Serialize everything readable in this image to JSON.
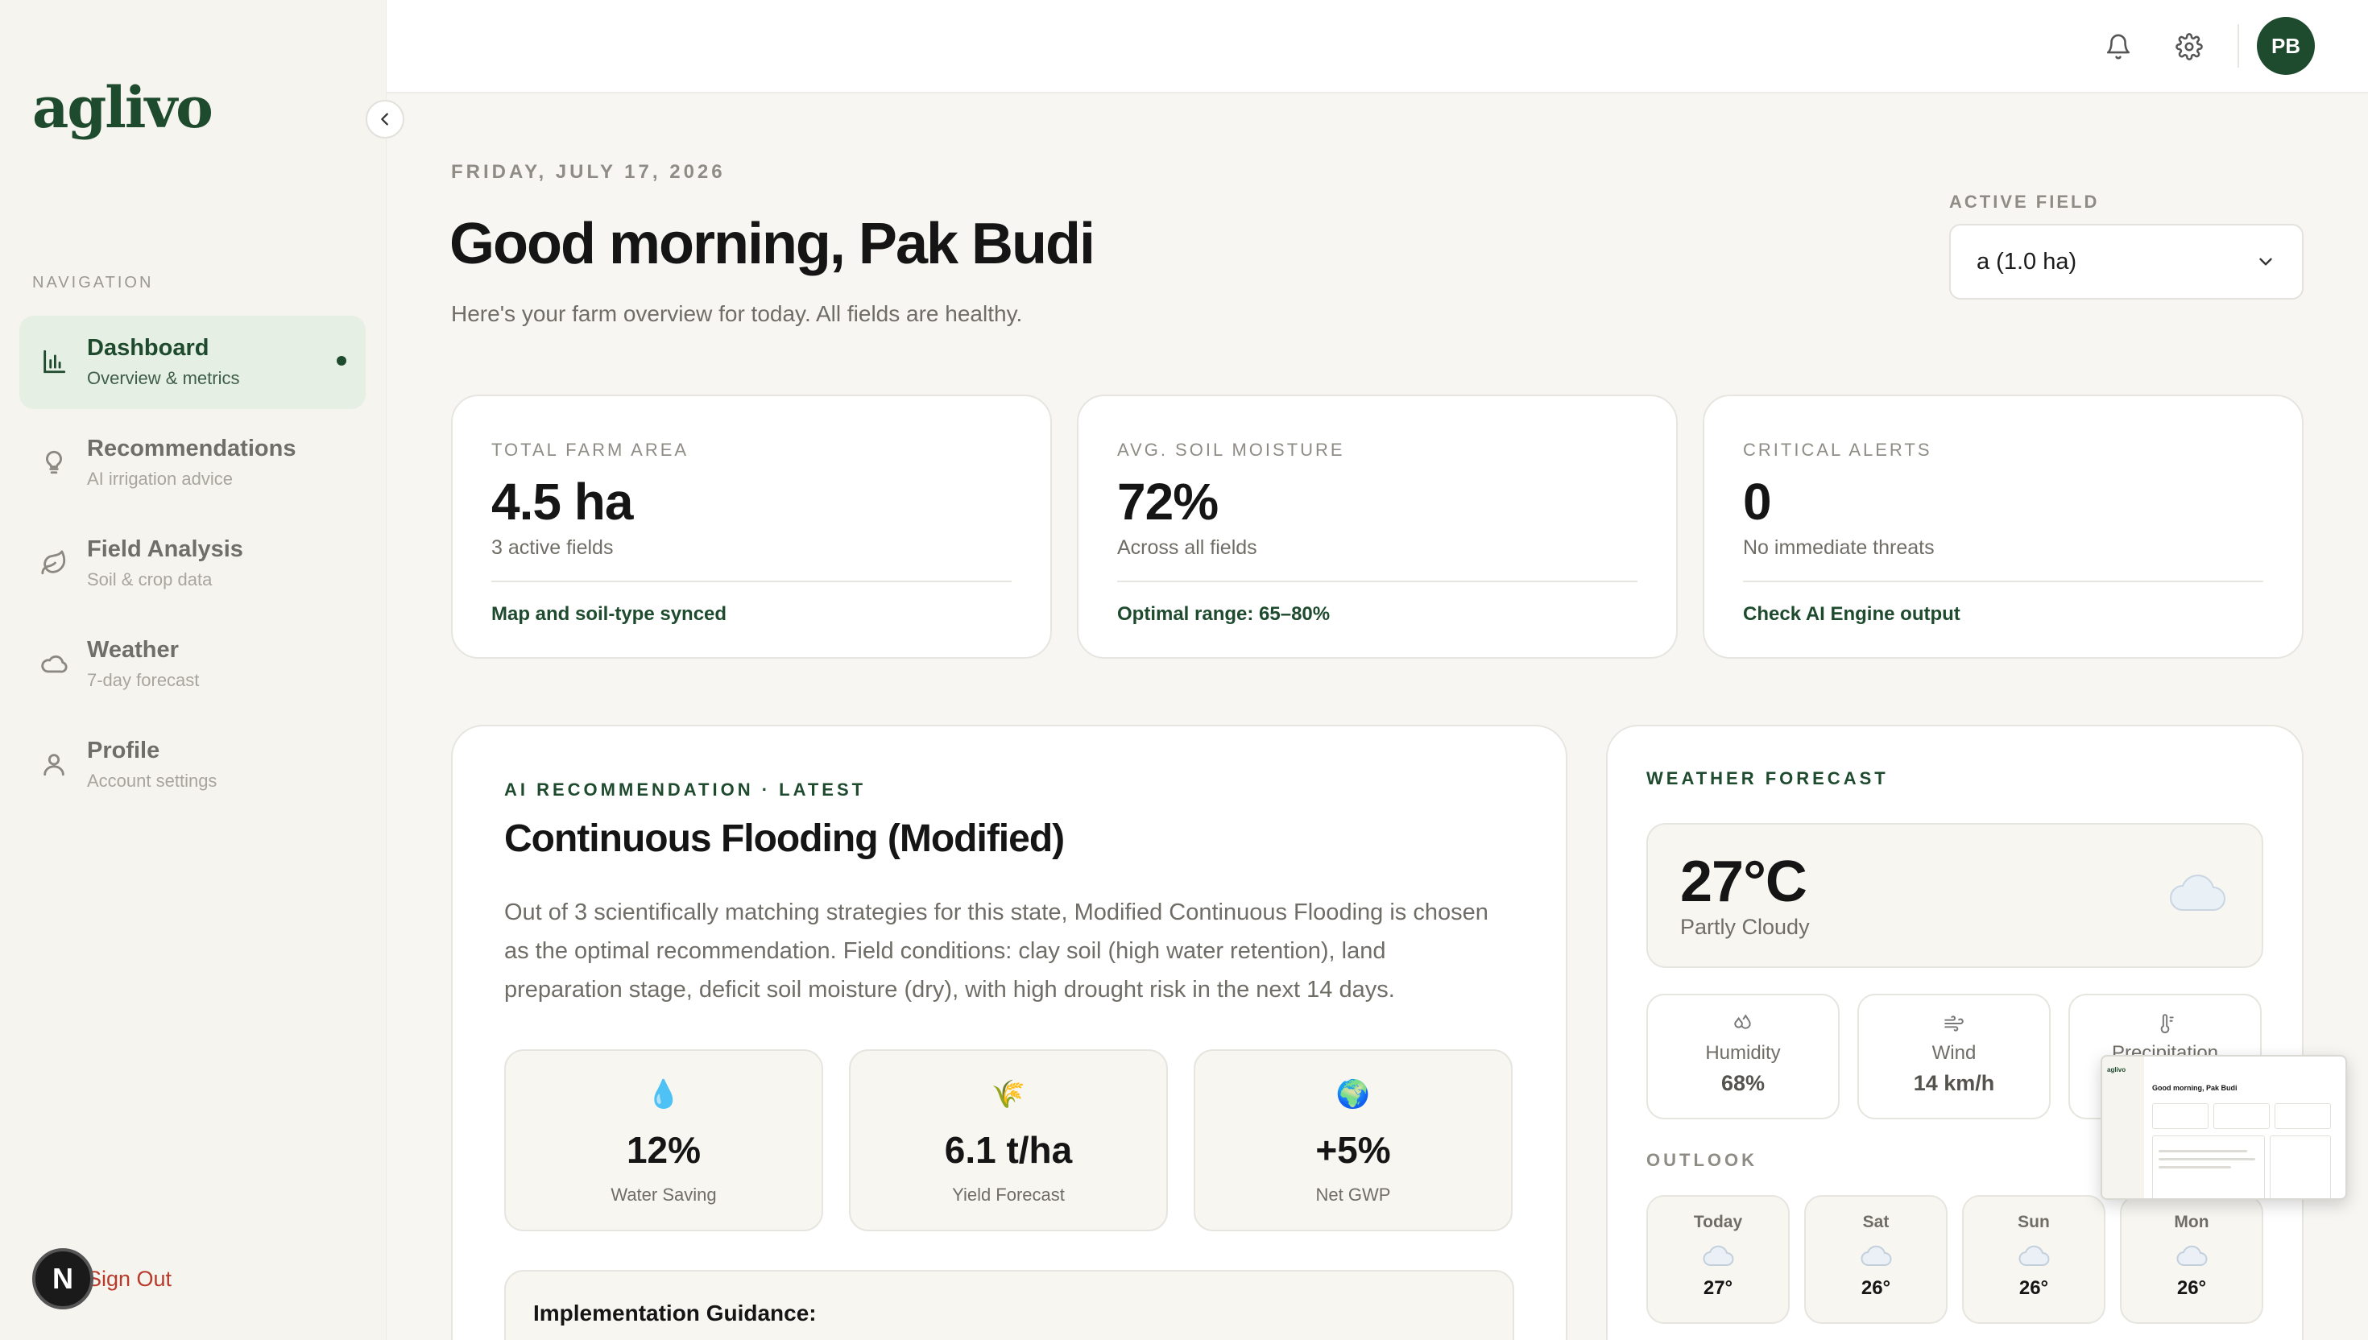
{
  "app": {
    "logo_text": "aglivo",
    "nav_label": "NAVIGATION",
    "signout_label": "Sign Out",
    "n_badge": "N"
  },
  "sidebar": {
    "items": [
      {
        "label": "Dashboard",
        "sub": "Overview & metrics",
        "icon": "bar-chart-icon",
        "active": true
      },
      {
        "label": "Recommendations",
        "sub": "AI irrigation advice",
        "icon": "lightbulb-icon",
        "active": false
      },
      {
        "label": "Field Analysis",
        "sub": "Soil & crop data",
        "icon": "leaf-icon",
        "active": false
      },
      {
        "label": "Weather",
        "sub": "7-day forecast",
        "icon": "cloud-icon",
        "active": false
      },
      {
        "label": "Profile",
        "sub": "Account settings",
        "icon": "user-icon",
        "active": false
      }
    ]
  },
  "topbar": {
    "avatar_initials": "PB",
    "icons": [
      "bell-icon",
      "gear-icon"
    ]
  },
  "header": {
    "date": "FRIDAY, JULY 17, 2026",
    "greeting": "Good morning, Pak Budi",
    "subtitle": "Here's your farm overview for today. All fields are healthy.",
    "active_field_label": "ACTIVE FIELD",
    "active_field_value": "a (1.0 ha)"
  },
  "stats": [
    {
      "label": "TOTAL FARM AREA",
      "value": "4.5 ha",
      "sub": "3 active fields",
      "foot": "Map and soil-type synced"
    },
    {
      "label": "AVG. SOIL MOISTURE",
      "value": "72%",
      "sub": "Across all fields",
      "foot": "Optimal range: 65–80%"
    },
    {
      "label": "CRITICAL ALERTS",
      "value": "0",
      "sub": "No immediate threats",
      "foot": "Check AI Engine output"
    }
  ],
  "recommendation": {
    "kicker": "AI RECOMMENDATION · LATEST",
    "title": "Continuous Flooding (Modified)",
    "body": "Out of 3 scientifically matching strategies for this state, Modified Continuous Flooding is chosen as the optimal recommendation. Field conditions: clay soil (high water retention), land preparation stage, deficit soil moisture (dry), with high drought risk in the next 14 days.",
    "metrics": [
      {
        "icon": "💧",
        "icon_name": "droplet-icon",
        "value": "12%",
        "label": "Water Saving"
      },
      {
        "icon": "🌾",
        "icon_name": "rice-icon",
        "value": "6.1 t/ha",
        "label": "Yield Forecast"
      },
      {
        "icon": "🌍",
        "icon_name": "globe-icon",
        "value": "+5%",
        "label": "Net GWP"
      }
    ],
    "guidance_title": "Implementation Guidance:"
  },
  "weather": {
    "kicker": "WEATHER FORECAST",
    "temp": "27°C",
    "condition": "Partly Cloudy",
    "stats": [
      {
        "label": "Humidity",
        "value": "68%",
        "icon": "humidity-icon"
      },
      {
        "label": "Wind",
        "value": "14 km/h",
        "icon": "wind-icon"
      },
      {
        "label": "Precipitation",
        "value": "",
        "icon": "thermometer-icon"
      }
    ],
    "outlook_label": "OUTLOOK",
    "outlook": [
      {
        "day": "Today",
        "temp": "27°"
      },
      {
        "day": "Sat",
        "temp": "26°"
      },
      {
        "day": "Sun",
        "temp": "26°"
      },
      {
        "day": "Mon",
        "temp": "26°"
      }
    ]
  },
  "thumbnail": {
    "title": "Good morning, Pak Budi",
    "logo": "aglivo"
  },
  "colors": {
    "brand": "#1e4a2e",
    "active_bg": "#e6efe3",
    "danger": "#b83a2a",
    "background": "#f7f6f2"
  }
}
